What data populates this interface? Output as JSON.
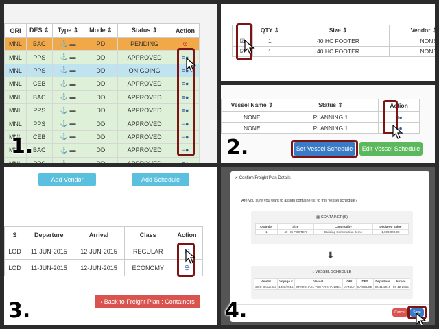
{
  "step_labels": [
    "1.",
    "2.",
    "3.",
    "4."
  ],
  "panel1": {
    "headers": [
      "ORI",
      "DES",
      "Type",
      "Mode",
      "Status",
      "Action"
    ],
    "rows": [
      {
        "ori": "MNL",
        "des": "BAC",
        "mode": "PD",
        "status": "PENDING",
        "kind": "pending"
      },
      {
        "ori": "MNL",
        "des": "PPS",
        "mode": "DD",
        "status": "APPROVED",
        "kind": "approved"
      },
      {
        "ori": "MNL",
        "des": "PPS",
        "mode": "DD",
        "status": "ON GOING",
        "kind": "ongoing"
      },
      {
        "ori": "MNL",
        "des": "CEB",
        "mode": "DD",
        "status": "APPROVED",
        "kind": "approved"
      },
      {
        "ori": "MNL",
        "des": "BAC",
        "mode": "DD",
        "status": "APPROVED",
        "kind": "approved"
      },
      {
        "ori": "MNL",
        "des": "PPS",
        "mode": "DD",
        "status": "APPROVED",
        "kind": "approved"
      },
      {
        "ori": "MNL",
        "des": "PPS",
        "mode": "DD",
        "status": "APPROVED",
        "kind": "approved"
      },
      {
        "ori": "MNL",
        "des": "CEB",
        "mode": "DD",
        "status": "APPROVED",
        "kind": "approved"
      },
      {
        "ori": "MNL",
        "des": "BAC",
        "mode": "DD",
        "status": "APPROVED",
        "kind": "approved"
      },
      {
        "ori": "MNL",
        "des": "PPS",
        "mode": "DD",
        "status": "APPROVED",
        "kind": "approved"
      }
    ]
  },
  "panel2": {
    "headers": [
      "QTY",
      "Size",
      "Vendor"
    ],
    "rows": [
      {
        "qty": "1",
        "size": "40 HC FOOTER",
        "vendor": "NONE"
      },
      {
        "qty": "1",
        "size": "40 HC FOOTER",
        "vendor": "NONE"
      }
    ]
  },
  "panel2b": {
    "headers": [
      "Vessel Name",
      "Status",
      "Action"
    ],
    "rows": [
      {
        "vessel": "NONE",
        "status": "PLANNING 1"
      },
      {
        "vessel": "NONE",
        "status": "PLANNING 1"
      }
    ],
    "set_button": "Set Vessel Schedule",
    "edit_button": "Edit Vessel Schedule"
  },
  "panel3": {
    "add_vendor": "Add Vendor",
    "add_schedule": "Add Schedule",
    "headers": [
      "S",
      "Departure",
      "Arrival",
      "Class",
      "Action"
    ],
    "rows": [
      {
        "s": "LOD",
        "departure": "11-JUN-2015",
        "arrival": "12-JUN-2015",
        "class": "REGULAR"
      },
      {
        "s": "LOD",
        "departure": "11-JUN-2015",
        "arrival": "12-JUN-2015",
        "class": "ECONOMY"
      }
    ],
    "back_button": "Back to Freight Plan : Containers"
  },
  "panel4": {
    "title": "Confirm Freight Plan Details",
    "question": "Are you sure you want to assign container(s) to this vessel schedule?",
    "containers_title": "CONTAINER(S)",
    "containers_headers": [
      "Quantity",
      "Size",
      "Commodity",
      "Declared Value"
    ],
    "containers_row": [
      "1",
      "40 HC FOOTER",
      "Building Construction Items",
      "1,000,000.00"
    ],
    "vessel_title": "VESSEL SCHEDULE",
    "vessel_headers": [
      "Vendor",
      "Voyage #",
      "Vessel",
      "ORI",
      "DES",
      "Departure",
      "Arrival"
    ],
    "vessel_row": [
      "2GO Group Inc",
      "1303/2015",
      "ST MICHAEL THE ARCHANGEL",
      "MANILA",
      "BACOLOD",
      "06-11-2015",
      "06-12-2015"
    ],
    "cancel_button": "Cancel",
    "save_button": "Save"
  },
  "colors": {
    "pending": "#f0a848",
    "approved": "#dff0d8",
    "ongoing": "#bfe3ef",
    "primary": "#3a7bc8",
    "success": "#5cb85c",
    "danger": "#d9534f",
    "info": "#5bc0de",
    "highlight": "#7c1414"
  }
}
